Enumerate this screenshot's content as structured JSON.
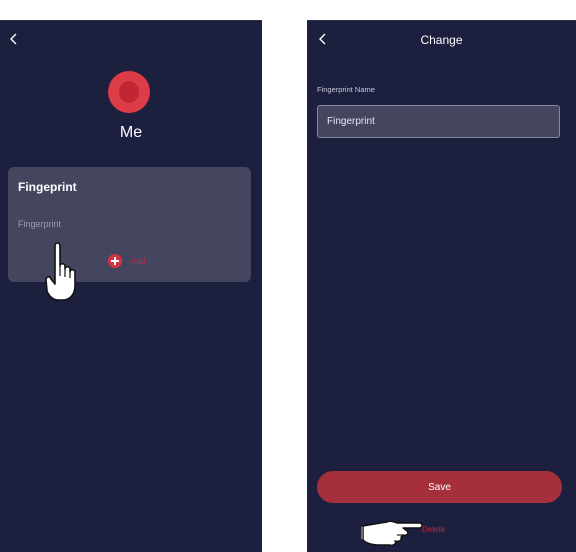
{
  "left_screen": {
    "user_name": "Me",
    "card": {
      "title": "Fingeprint",
      "items": [
        "Fingerprint"
      ],
      "add_label": "Add"
    }
  },
  "right_screen": {
    "title": "Change",
    "field_label": "Fingerprint Name",
    "field_value": "Fingerprint",
    "save_label": "Save",
    "delete_label": "Delete"
  },
  "colors": {
    "background": "#1d1f3f",
    "card": "#44465f",
    "accent_red": "#dd3c47",
    "save_button": "#a5303b",
    "text_red": "#c4283b"
  }
}
